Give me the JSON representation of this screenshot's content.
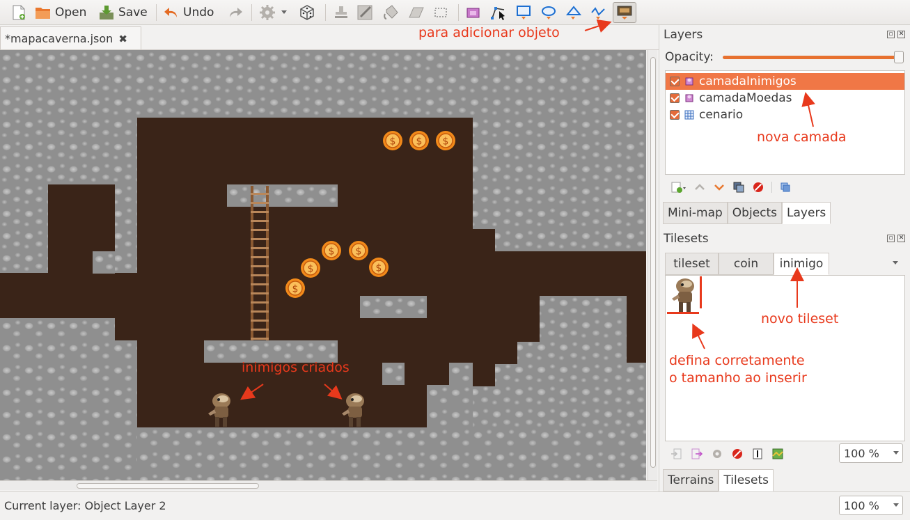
{
  "toolbar": {
    "new_icon": "new-document-icon",
    "open_label": "Open",
    "save_label": "Save",
    "undo_label": "Undo",
    "redo_icon": "redo-icon"
  },
  "document_tab": {
    "title": "*mapacaverna.json",
    "close_glyph": "✖"
  },
  "annotations": {
    "add_object": "para adicionar objeto",
    "new_layer": "nova camada",
    "new_tileset": "novo tileset",
    "size_hint_line1": "defina corretamente",
    "size_hint_line2": "o tamanho ao inserir",
    "enemies_created": "inimigos criados"
  },
  "layers_panel": {
    "title": "Layers",
    "opacity_label": "Opacity:",
    "opacity": 1.0,
    "layers": [
      {
        "name": "camadaInimigos",
        "type": "object",
        "visible": true,
        "selected": true
      },
      {
        "name": "camadaMoedas",
        "type": "object",
        "visible": true,
        "selected": false
      },
      {
        "name": "cenario",
        "type": "tile",
        "visible": true,
        "selected": false
      }
    ],
    "bottom_tabs": [
      "Mini-map",
      "Objects",
      "Layers"
    ],
    "active_tab": "Layers"
  },
  "tilesets_panel": {
    "title": "Tilesets",
    "tabs": [
      "tileset",
      "coin",
      "inimigo"
    ],
    "active_tab": "inimigo",
    "zoom": "100 %",
    "bottom_tabs": [
      "Terrains",
      "Tilesets"
    ],
    "active_bottom_tab": "Tilesets"
  },
  "status": {
    "current_layer": "Current layer: Object Layer 2",
    "zoom": "100 %"
  },
  "colors": {
    "accent": "#f07746",
    "annotation": "#e8391c",
    "dirt": "#3a2418"
  }
}
